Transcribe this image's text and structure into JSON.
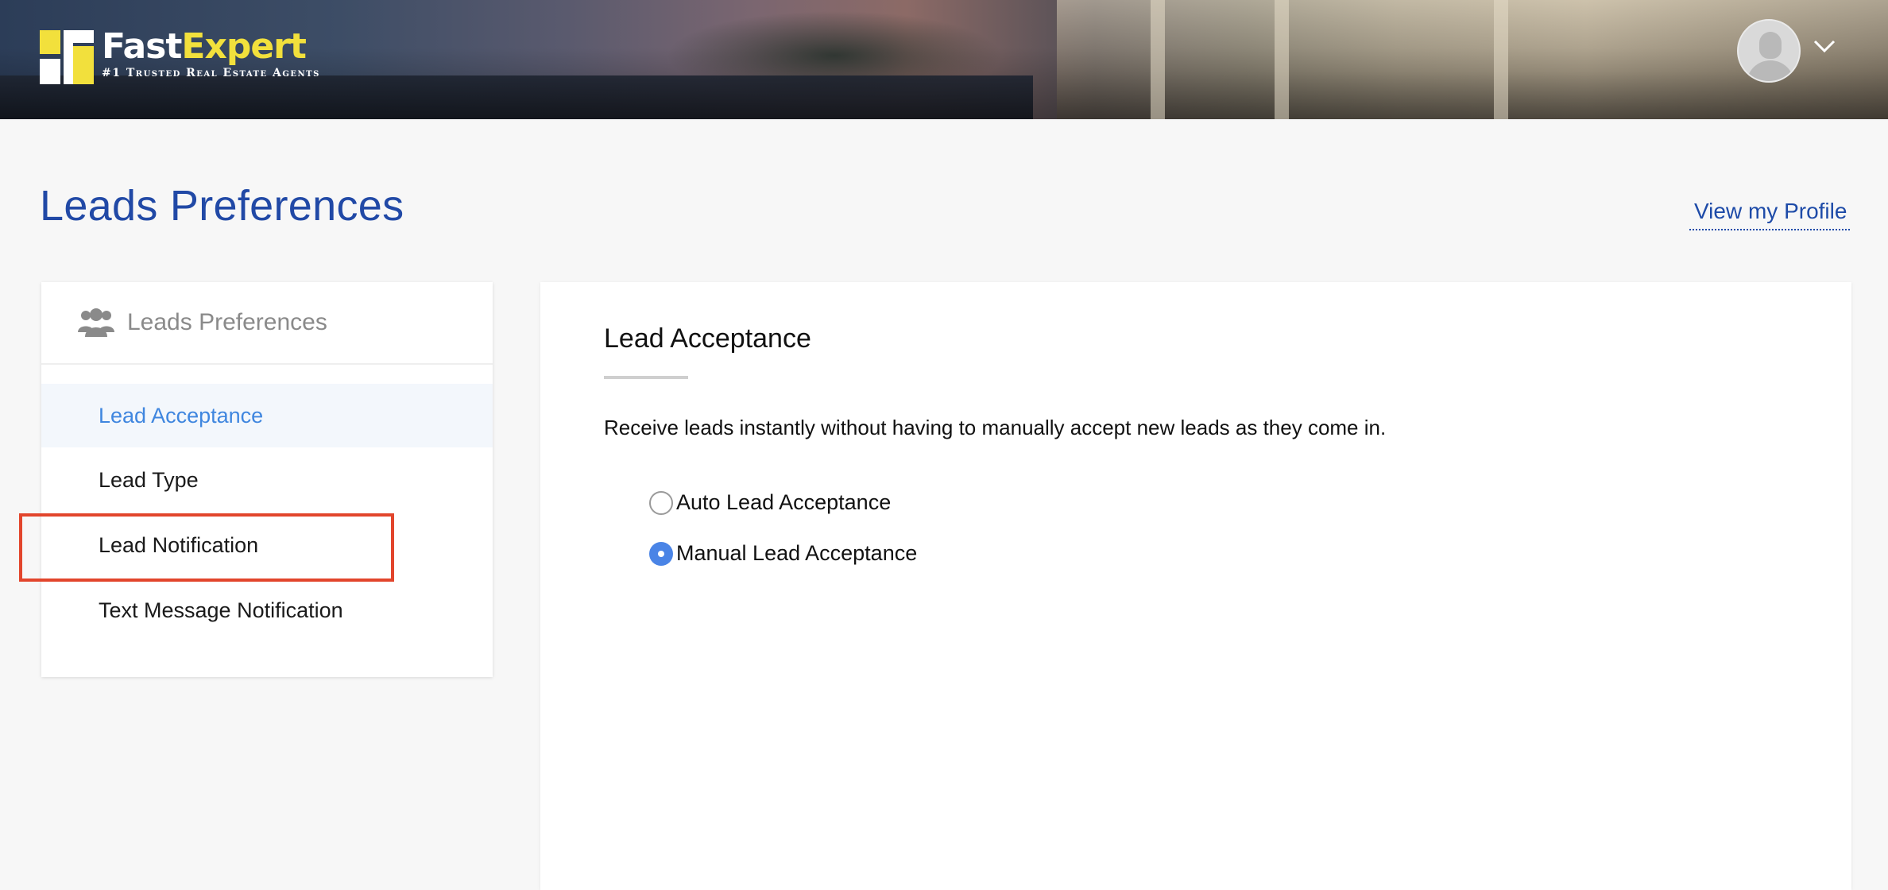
{
  "header": {
    "logo": {
      "name_part1": "Fast",
      "name_part2": "Expert",
      "tagline": "#1 Trusted Real Estate Agents",
      "mark_color": "#f2e03c"
    },
    "user_menu": {
      "avatar_icon": "user-avatar-icon",
      "dropdown_icon": "chevron-down-icon"
    }
  },
  "page": {
    "title": "Leads Preferences",
    "view_profile_link": "View my Profile"
  },
  "sidebar": {
    "heading": "Leads Preferences",
    "heading_icon": "users-group-icon",
    "items": [
      {
        "label": "Lead Acceptance",
        "active": true
      },
      {
        "label": "Lead Type",
        "active": false
      },
      {
        "label": "Lead Notification",
        "active": false
      },
      {
        "label": "Text Message Notification",
        "active": false
      }
    ]
  },
  "main": {
    "section_title": "Lead Acceptance",
    "description": "Receive leads instantly without having to manually accept new leads as they come in.",
    "options": [
      {
        "label": "Auto Lead Acceptance",
        "selected": false
      },
      {
        "label": "Manual Lead Acceptance",
        "selected": true
      }
    ]
  },
  "colors": {
    "title_blue": "#2149a6",
    "active_item_blue": "#3f86df",
    "radio_selected": "#4a84e6",
    "highlight_red": "#e2452c"
  }
}
